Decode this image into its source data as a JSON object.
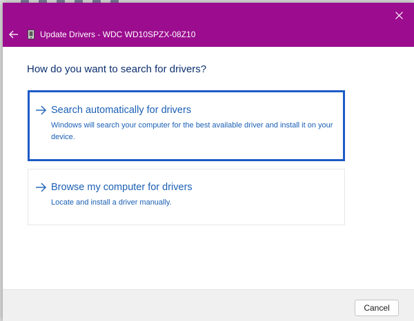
{
  "window": {
    "title": "Update Drivers - WDC WD10SPZX-08Z10",
    "accent_color": "#9b0c8e"
  },
  "icons": {
    "close": "close-icon",
    "back": "arrow-left-icon",
    "device": "drive-icon",
    "option_arrow": "arrow-right-icon"
  },
  "main": {
    "question": "How do you want to search for drivers?",
    "options": [
      {
        "title": "Search automatically for drivers",
        "description": "Windows will search your computer for the best available driver and install it on your device.",
        "selected": true
      },
      {
        "title": "Browse my computer for drivers",
        "description": "Locate and install a driver manually.",
        "selected": false
      }
    ],
    "link_color": "#1a5fb4",
    "focus_color": "#1c5ac6"
  },
  "footer": {
    "cancel_label": "Cancel"
  }
}
